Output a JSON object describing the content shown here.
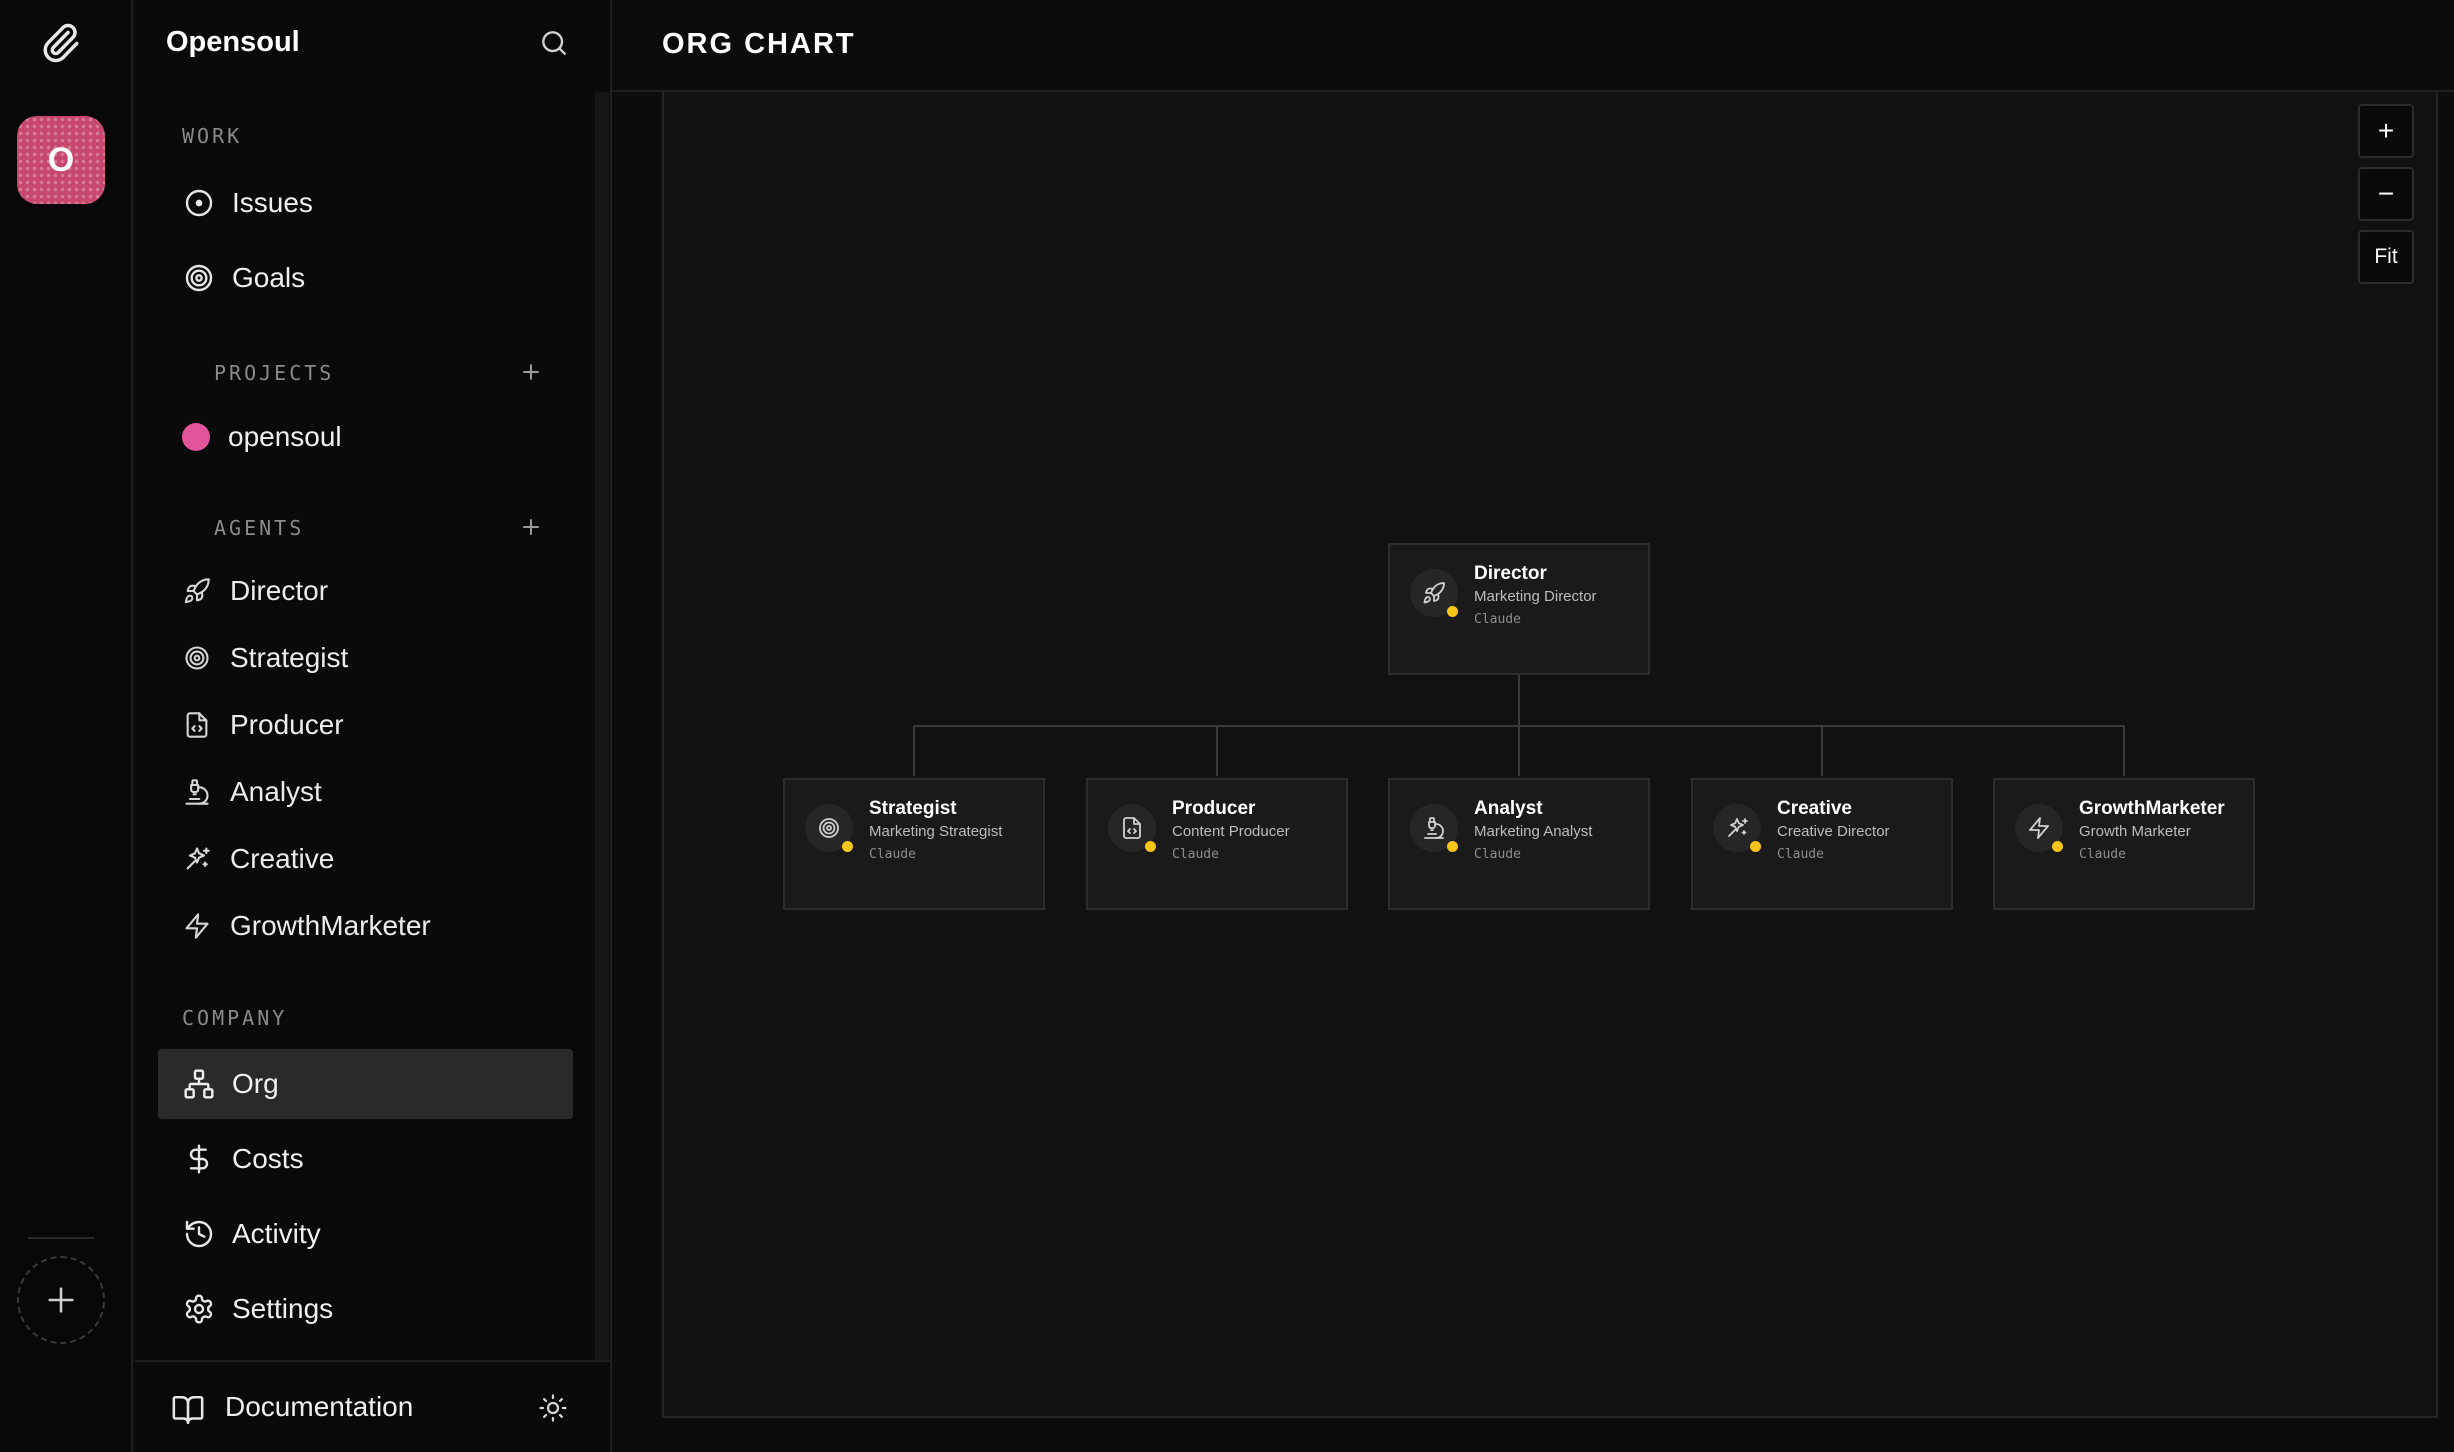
{
  "app": {
    "company_name": "Opensoul",
    "org_initial": "O"
  },
  "sidebar": {
    "work_label": "WORK",
    "work_items": [
      {
        "label": "Issues",
        "icon": "circle-dot-icon"
      },
      {
        "label": "Goals",
        "icon": "target-icon"
      }
    ],
    "projects_label": "PROJECTS",
    "projects": [
      {
        "label": "opensoul",
        "color": "#e3559a"
      }
    ],
    "agents_label": "AGENTS",
    "agents": [
      {
        "label": "Director",
        "icon": "rocket-icon"
      },
      {
        "label": "Strategist",
        "icon": "target-icon"
      },
      {
        "label": "Producer",
        "icon": "file-code-icon"
      },
      {
        "label": "Analyst",
        "icon": "microscope-icon"
      },
      {
        "label": "Creative",
        "icon": "sparkles-icon"
      },
      {
        "label": "GrowthMarketer",
        "icon": "zap-icon"
      }
    ],
    "company_label": "COMPANY",
    "company_items": [
      {
        "label": "Org",
        "icon": "network-icon",
        "active": true
      },
      {
        "label": "Costs",
        "icon": "dollar-icon"
      },
      {
        "label": "Activity",
        "icon": "history-icon"
      },
      {
        "label": "Settings",
        "icon": "gear-icon"
      }
    ],
    "footer": {
      "documentation_label": "Documentation"
    }
  },
  "header": {
    "title": "ORG CHART"
  },
  "zoom": {
    "in_label": "+",
    "out_label": "−",
    "fit_label": "Fit"
  },
  "org_chart": {
    "root": {
      "name": "Director",
      "role": "Marketing Director",
      "model": "Claude",
      "icon": "rocket-icon"
    },
    "reports": [
      {
        "name": "Strategist",
        "role": "Marketing Strategist",
        "model": "Claude",
        "icon": "target-icon"
      },
      {
        "name": "Producer",
        "role": "Content Producer",
        "model": "Claude",
        "icon": "file-code-icon"
      },
      {
        "name": "Analyst",
        "role": "Marketing Analyst",
        "model": "Claude",
        "icon": "microscope-icon"
      },
      {
        "name": "Creative",
        "role": "Creative Director",
        "model": "Claude",
        "icon": "sparkles-icon"
      },
      {
        "name": "GrowthMarketer",
        "role": "Growth Marketer",
        "model": "Claude",
        "icon": "zap-icon"
      }
    ],
    "status_color": "#f5c518"
  }
}
